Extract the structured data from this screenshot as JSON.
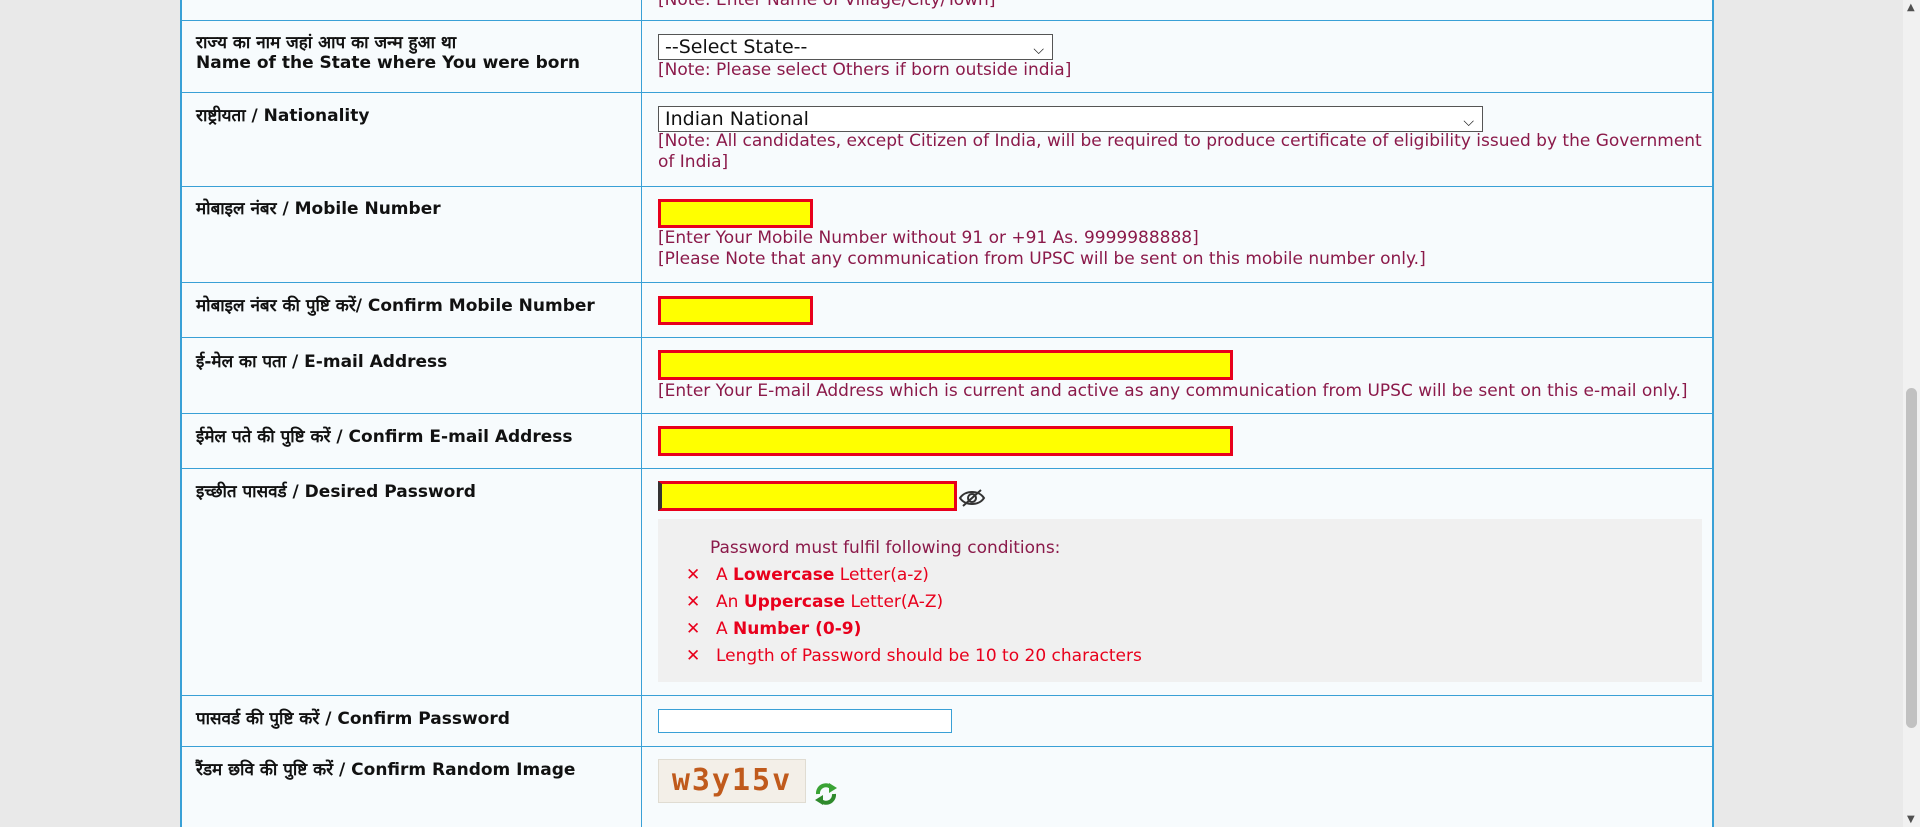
{
  "state": {
    "prev_note": "[Note: Enter Name of Village/City/Town]",
    "label_hi": "राज्य का नाम जहां आप का जन्म हुआ था",
    "label_en": "Name of the State where You were born",
    "select_value": "--Select State--",
    "note": "[Note: Please select Others if born outside india]"
  },
  "nationality": {
    "label": "राष्ट्रीयता / Nationality",
    "select_value": "Indian National",
    "note": "[Note: All candidates, except Citizen of India, will be required to produce certificate of eligibility issued by the Government of India]"
  },
  "mobile": {
    "label": "मोबाइल नंबर / Mobile Number",
    "value": "",
    "note1": "[Enter Your Mobile Number without 91 or +91 As. 9999988888]",
    "note2": "[Please Note that any communication from UPSC will be sent on this mobile number only.]"
  },
  "confirm_mobile": {
    "label": "मोबाइल नंबर की पुष्टि करें/ Confirm Mobile Number",
    "value": ""
  },
  "email": {
    "label": "ई-मेल का पता / E-mail Address",
    "value": "",
    "note": "[Enter Your E-mail Address which is current and active as any communication from UPSC will be sent on this e-mail only.]"
  },
  "confirm_email": {
    "label": "ईमेल पते की पुष्टि करें / Confirm E-mail Address",
    "value": ""
  },
  "password": {
    "label": "इच्छीत पासवर्ड / Desired Password",
    "value": "",
    "eye_icon": "eye-slash-icon",
    "conditions_title": "Password must fulfil following conditions:",
    "conditions": [
      {
        "mark": "✕",
        "pre": "A ",
        "bold": "Lowercase",
        "post": " Letter(a-z)"
      },
      {
        "mark": "✕",
        "pre": "An ",
        "bold": "Uppercase",
        "post": " Letter(A-Z)"
      },
      {
        "mark": "✕",
        "pre": "A ",
        "bold": "Number (0-9)",
        "post": ""
      },
      {
        "mark": "✕",
        "pre": "",
        "bold": "",
        "post": "Length of Password should be 10 to 20 characters"
      }
    ]
  },
  "confirm_password": {
    "label": "पासवर्ड की पुष्टि करें / Confirm Password",
    "value": ""
  },
  "captcha": {
    "label": "रैंडम छवि की पुष्टि करें / Confirm Random Image",
    "image_text": "w3y15v",
    "refresh_icon": "refresh-icon"
  },
  "colors": {
    "border": "#39a0d6",
    "note": "#8b1a4a",
    "error": "#e8001c",
    "highlight": "#ffff00"
  }
}
